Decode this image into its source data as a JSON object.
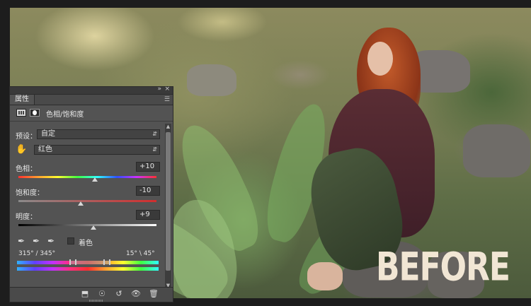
{
  "canvas": {
    "overlay_text": "BEFORE"
  },
  "panel": {
    "tab_label": "属性",
    "title": "色相/饱和度",
    "preset_label": "预设：",
    "preset_value": "自定",
    "channel_value": "红色",
    "hue": {
      "label": "色相：",
      "value": "+10",
      "fraction": 0.555
    },
    "saturation": {
      "label": "饱和度：",
      "value": "-10",
      "fraction": 0.45
    },
    "lightness": {
      "label": "明度：",
      "value": "+9",
      "fraction": 0.545
    },
    "colorize_label": "着色",
    "range_left": "315° / 345°",
    "range_right": "15° \\ 45°"
  },
  "icons": {
    "panel_collapse": "double-chevron-icon",
    "panel_close": "close-icon",
    "panel_menu": "panel-menu-icon",
    "adjustment": "hue-saturation-adjustment-icon",
    "mask": "layer-mask-icon",
    "targeted_adjust": "hand-icon",
    "eyedroppers": [
      "eyedropper-icon",
      "eyedropper-plus-icon",
      "eyedropper-minus-icon"
    ],
    "footer": [
      "clip-to-layer-icon",
      "view-previous-icon",
      "reset-icon",
      "visibility-icon",
      "trash-icon"
    ]
  },
  "colors": {
    "panel_bg": "#535353",
    "panel_dark": "#3a3a3a",
    "overlay_text": "#f1e6d4"
  }
}
